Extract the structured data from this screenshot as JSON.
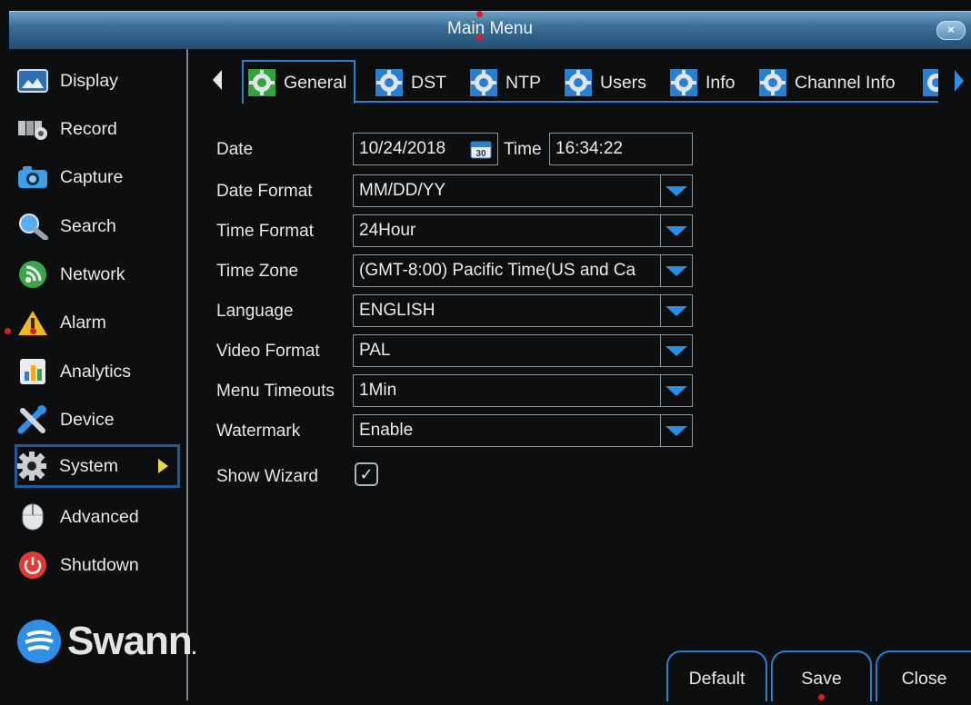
{
  "window": {
    "title": "Main Menu",
    "close_label": "×"
  },
  "sidebar": {
    "items": [
      {
        "label": "Display"
      },
      {
        "label": "Record"
      },
      {
        "label": "Capture"
      },
      {
        "label": "Search"
      },
      {
        "label": "Network"
      },
      {
        "label": "Alarm"
      },
      {
        "label": "Analytics"
      },
      {
        "label": "Device"
      },
      {
        "label": "System"
      },
      {
        "label": "Advanced"
      },
      {
        "label": "Shutdown"
      }
    ],
    "active_item": "System",
    "logo_text": "Swann",
    "logo_suffix": "."
  },
  "tabs": [
    {
      "label": "General"
    },
    {
      "label": "DST"
    },
    {
      "label": "NTP"
    },
    {
      "label": "Users"
    },
    {
      "label": "Info"
    },
    {
      "label": "Channel Info"
    }
  ],
  "active_tab": "General",
  "form": {
    "date_label": "Date",
    "date_value": "10/24/2018",
    "calendar_day": "30",
    "time_label": "Time",
    "time_value": "16:34:22",
    "date_format_label": "Date Format",
    "date_format_value": "MM/DD/YY",
    "time_format_label": "Time Format",
    "time_format_value": "24Hour",
    "time_zone_label": "Time Zone",
    "time_zone_value": "(GMT-8:00) Pacific Time(US and Ca",
    "language_label": "Language",
    "language_value": "ENGLISH",
    "video_format_label": "Video Format",
    "video_format_value": "PAL",
    "menu_timeouts_label": "Menu Timeouts",
    "menu_timeouts_value": "1Min",
    "watermark_label": "Watermark",
    "watermark_value": "Enable",
    "show_wizard_label": "Show Wizard",
    "show_wizard_checked": true
  },
  "buttons": {
    "default": "Default",
    "save": "Save",
    "close": "Close"
  },
  "colors": {
    "accent": "#2a7fd0",
    "titlebar": "#3c6f97",
    "marker": "#d3202a",
    "arrow": "#e8d94a"
  }
}
